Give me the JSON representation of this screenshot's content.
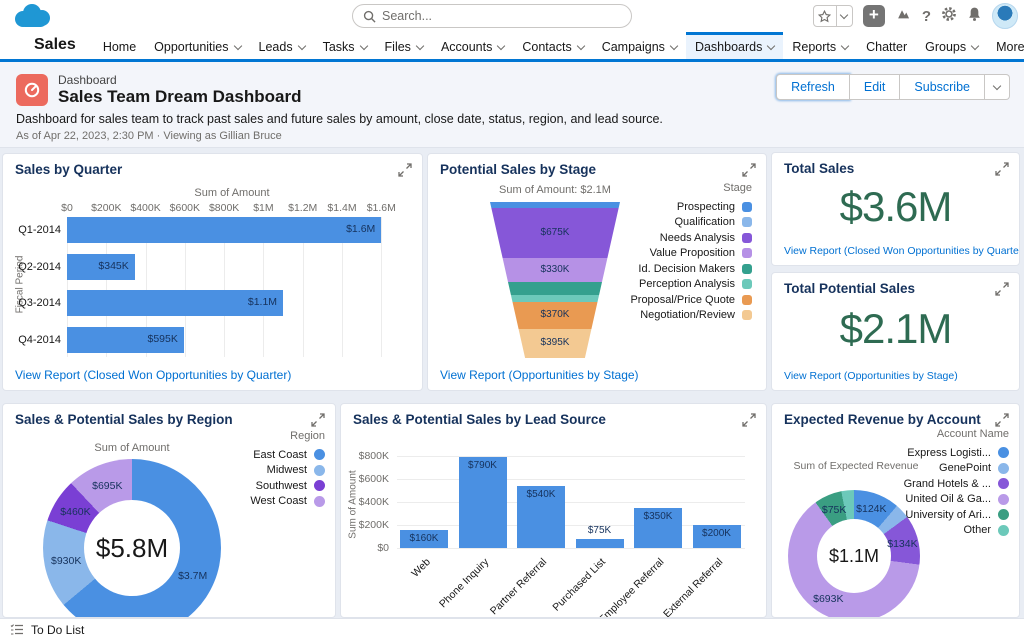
{
  "topbar": {
    "search_placeholder": "Search..."
  },
  "navbar": {
    "app_name": "Sales",
    "tabs": [
      {
        "label": "Home",
        "dropdown": false,
        "active": false
      },
      {
        "label": "Opportunities",
        "dropdown": true,
        "active": false
      },
      {
        "label": "Leads",
        "dropdown": true,
        "active": false
      },
      {
        "label": "Tasks",
        "dropdown": true,
        "active": false
      },
      {
        "label": "Files",
        "dropdown": true,
        "active": false
      },
      {
        "label": "Accounts",
        "dropdown": true,
        "active": false
      },
      {
        "label": "Contacts",
        "dropdown": true,
        "active": false
      },
      {
        "label": "Campaigns",
        "dropdown": true,
        "active": false
      },
      {
        "label": "Dashboards",
        "dropdown": true,
        "active": true
      },
      {
        "label": "Reports",
        "dropdown": true,
        "active": false
      },
      {
        "label": "Chatter",
        "dropdown": false,
        "active": false
      },
      {
        "label": "Groups",
        "dropdown": true,
        "active": false
      },
      {
        "label": "More",
        "dropdown": true,
        "active": false
      }
    ]
  },
  "header": {
    "type_label": "Dashboard",
    "title": "Sales Team Dream Dashboard",
    "description": "Dashboard for sales team to track past sales and future sales by amount, close date, status, region, and lead source.",
    "meta": "As of Apr 22, 2023, 2:30 PM · Viewing as Gillian Bruce",
    "buttons": [
      "Refresh",
      "Edit",
      "Subscribe"
    ]
  },
  "metrics": {
    "total_sales": {
      "title": "Total Sales",
      "value": "$3.6M",
      "link": "View Report (Closed Won Opportunities by Quarter)"
    },
    "total_potential_sales": {
      "title": "Total Potential Sales",
      "value": "$2.1M",
      "link": "View Report (Opportunities by Stage)"
    }
  },
  "colors": {
    "brand_blue": "#0176d3",
    "link_blue": "#0070d2",
    "bar_blue": "#4a90e2",
    "metric_green": "#2e6b52",
    "title_navy": "#16325c"
  },
  "chart_data": [
    {
      "id": "sales_by_quarter",
      "type": "bar",
      "orientation": "horizontal",
      "title": "Sales by Quarter",
      "axis_label": "Sum of Amount",
      "category_axis_label": "Fiscal Period",
      "categories": [
        "Q1-2014",
        "Q2-2014",
        "Q3-2014",
        "Q4-2014"
      ],
      "values": [
        1600000,
        345000,
        1100000,
        595000
      ],
      "value_labels": [
        "$1.6M",
        "$345K",
        "$1.1M",
        "$595K"
      ],
      "ticks": [
        "$0",
        "$200K",
        "$400K",
        "$600K",
        "$800K",
        "$1M",
        "$1.2M",
        "$1.4M",
        "$1.6M"
      ],
      "tick_values": [
        0,
        200000,
        400000,
        600000,
        800000,
        1000000,
        1200000,
        1400000,
        1600000
      ],
      "axis_max": 1680000,
      "bar_color": "#4a90e2",
      "grid": true,
      "link": "View Report (Closed Won Opportunities by Quarter)"
    },
    {
      "id": "potential_sales_by_stage",
      "type": "funnel",
      "title": "Potential Sales by Stage",
      "subtitle": "Sum of Amount: $2.1M",
      "legend_title": "Stage",
      "legend_position": "right",
      "segments": [
        {
          "label": "Prospecting",
          "color": "#4a90e2",
          "value": 80000,
          "value_label": ""
        },
        {
          "label": "Qualification",
          "color": "#8ab7ea",
          "value": 0,
          "value_label": ""
        },
        {
          "label": "Needs Analysis",
          "color": "#8657d8",
          "value": 675000,
          "value_label": "$675K"
        },
        {
          "label": "Value Proposition",
          "color": "#b691e6",
          "value": 330000,
          "value_label": "$330K"
        },
        {
          "label": "Id. Decision Makers",
          "color": "#34a08e",
          "value": 175000,
          "value_label": ""
        },
        {
          "label": "Perception Analysis",
          "color": "#6cc9ba",
          "value": 95000,
          "value_label": ""
        },
        {
          "label": "Proposal/Price Quote",
          "color": "#e99a52",
          "value": 370000,
          "value_label": "$370K"
        },
        {
          "label": "Negotiation/Review",
          "color": "#f3c992",
          "value": 395000,
          "value_label": "$395K"
        }
      ],
      "link": "View Report (Opportunities by Stage)"
    },
    {
      "id": "sales_by_region",
      "type": "pie",
      "subtype": "donut",
      "title": "Sales & Potential Sales by Region",
      "chart_label": "Sum of Amount",
      "legend_title": "Region",
      "legend_position": "right",
      "center_label": "$5.8M",
      "slices": [
        {
          "label": "East Coast",
          "color": "#4a90e2",
          "value": 3700000,
          "value_label": "$3.7M"
        },
        {
          "label": "Midwest",
          "color": "#8ab7ea",
          "value": 930000,
          "value_label": "$930K"
        },
        {
          "label": "Southwest",
          "color": "#7a3fd4",
          "value": 460000,
          "value_label": "$460K"
        },
        {
          "label": "West Coast",
          "color": "#b99ae8",
          "value": 695000,
          "value_label": "$695K"
        }
      ]
    },
    {
      "id": "sales_by_lead_source",
      "type": "bar",
      "orientation": "vertical",
      "title": "Sales & Potential Sales by Lead Source",
      "ylabel": "Sum of Amount",
      "categories": [
        "Web",
        "Phone Inquiry",
        "Partner Referral",
        "Purchased List",
        "Employee Referral",
        "External Referral"
      ],
      "values": [
        160000,
        790000,
        540000,
        75000,
        350000,
        200000
      ],
      "value_labels": [
        "$160K",
        "$790K",
        "$540K",
        "$75K",
        "$350K",
        "$200K"
      ],
      "ticks": [
        "$0",
        "$200K",
        "$400K",
        "$600K",
        "$800K"
      ],
      "tick_values": [
        0,
        200000,
        400000,
        600000,
        800000
      ],
      "axis_max": 800000,
      "bar_color": "#4a90e2",
      "grid": true
    },
    {
      "id": "expected_revenue_by_account",
      "type": "pie",
      "subtype": "donut",
      "title": "Expected Revenue by Account",
      "chart_label": "Sum of Expected Revenue",
      "legend_title": "Account Name",
      "legend_position": "right",
      "center_label": "$1.1M",
      "slices": [
        {
          "label": "Express Logisti...",
          "color": "#4a90e2",
          "value": 124000,
          "value_label": "$124K"
        },
        {
          "label": "GenePoint",
          "color": "#8ab7ea",
          "value": 40000,
          "value_label": ""
        },
        {
          "label": "Grand Hotels & ...",
          "color": "#8657d8",
          "value": 134000,
          "value_label": "$134K"
        },
        {
          "label": "United Oil & Ga...",
          "color": "#b99ae8",
          "value": 693000,
          "value_label": "$693K"
        },
        {
          "label": "University of Ari...",
          "color": "#3a9e82",
          "value": 75000,
          "value_label": "$75K"
        },
        {
          "label": "Other",
          "color": "#6cc9ba",
          "value": 34000,
          "value_label": ""
        }
      ]
    }
  ],
  "footer": {
    "label": "To Do List"
  }
}
